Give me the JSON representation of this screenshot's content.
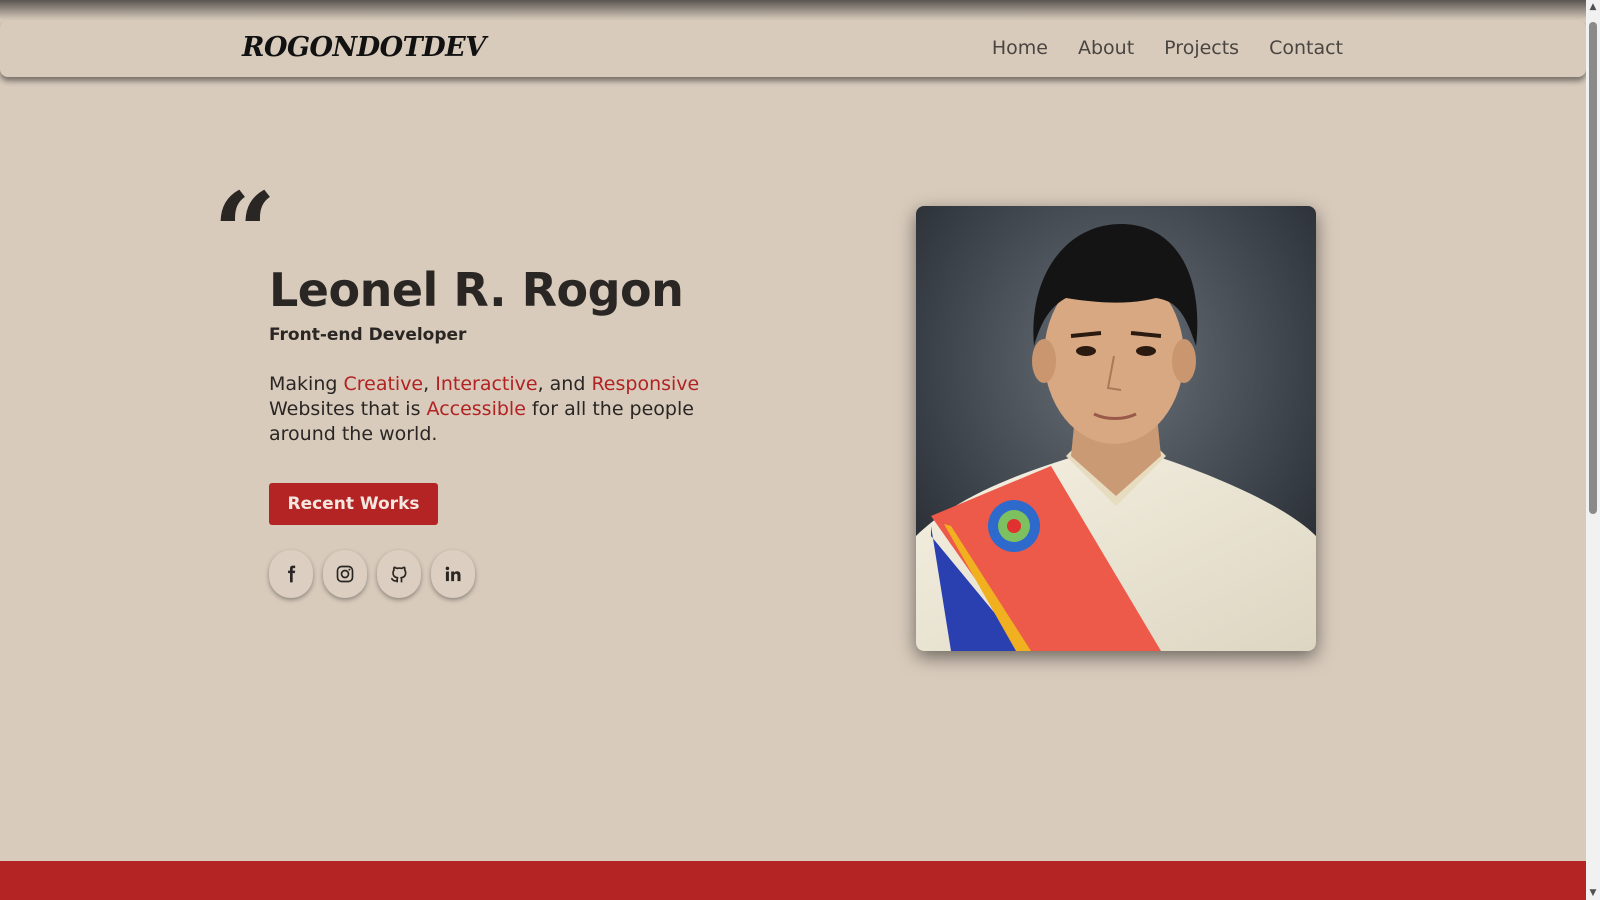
{
  "navbar": {
    "logo": "ROGONDOTDEV",
    "links": [
      "Home",
      "About",
      "Projects",
      "Contact"
    ]
  },
  "hero": {
    "quote_mark": "“",
    "name": "Leonel R. Rogon",
    "role": "Front-end Developer",
    "tagline": {
      "p1": "Making ",
      "w1": "Creative",
      "p2": ", ",
      "w2": "Interactive",
      "p3": ", and ",
      "w3": "Responsive",
      "p4": " Websites that is ",
      "w4": "Accessible",
      "p5": " for all the people around the world."
    },
    "button_label": "Recent Works",
    "socials": [
      "facebook-icon",
      "instagram-icon",
      "github-icon",
      "linkedin-icon"
    ]
  },
  "colors": {
    "background": "#d8cbbc",
    "accent": "#b52424",
    "text": "#2a2624"
  }
}
